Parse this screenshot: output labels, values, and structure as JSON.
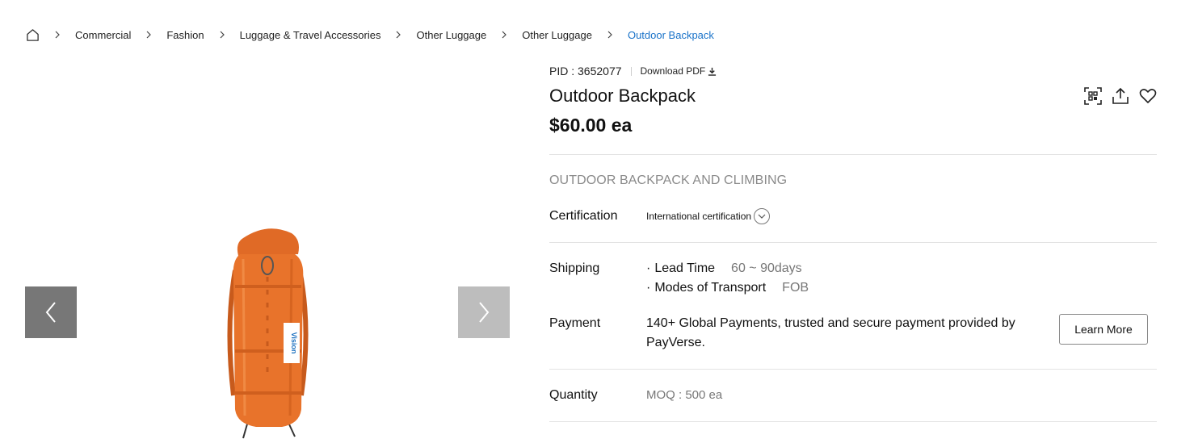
{
  "breadcrumb": {
    "items": [
      "Commercial",
      "Fashion",
      "Luggage & Travel Accessories",
      "Other Luggage",
      "Other Luggage"
    ],
    "current": "Outdoor Backpack"
  },
  "gallery": {
    "badge_text": "Vision",
    "product_color": "#e8732b"
  },
  "product": {
    "pid_label": "PID : 3652077",
    "download_label": "Download PDF",
    "title": "Outdoor Backpack",
    "price": "$60.00 ea",
    "subtitle": "OUTDOOR BACKPACK AND CLIMBING"
  },
  "certification": {
    "label": "Certification",
    "value": "International certification"
  },
  "shipping": {
    "label": "Shipping",
    "lines": [
      {
        "bullet": "·",
        "key": "Lead Time",
        "value": "60 ~ 90days"
      },
      {
        "bullet": "·",
        "key": "Modes of Transport",
        "value": "FOB"
      }
    ]
  },
  "payment": {
    "label": "Payment",
    "text": "140+ Global Payments, trusted and secure payment provided by PayVerse.",
    "button": "Learn More"
  },
  "quantity": {
    "label": "Quantity",
    "moq": "MOQ : 500 ea"
  },
  "colors": {
    "accent": "#1a73c9",
    "arrow_prev_bg": "#777777",
    "arrow_next_bg": "#bdbdbd"
  }
}
